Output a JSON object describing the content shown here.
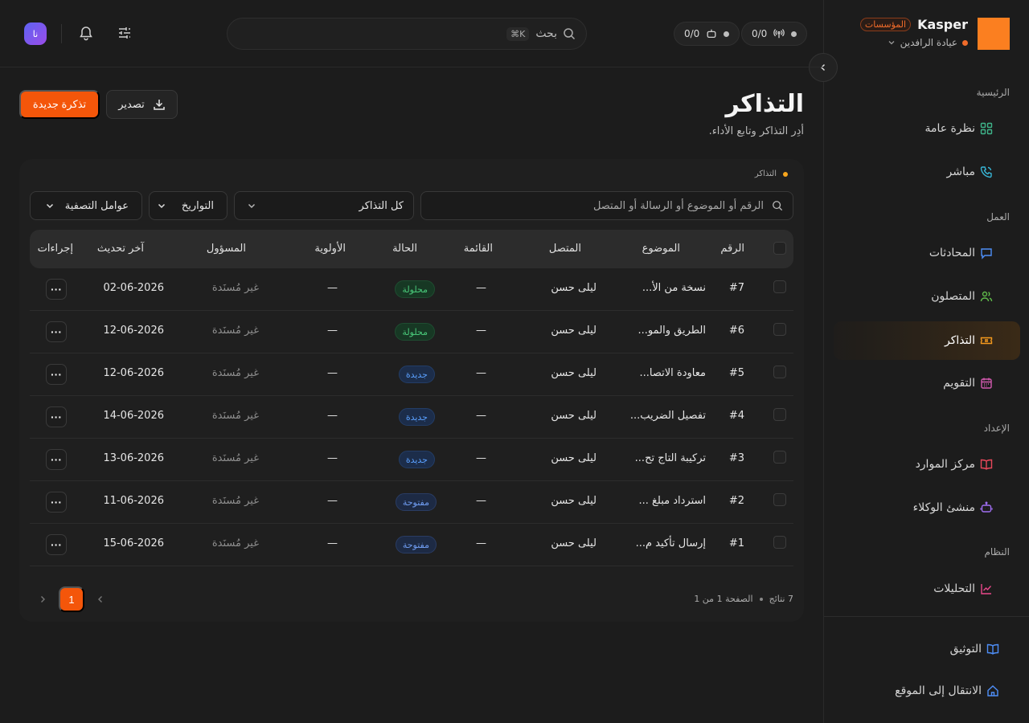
{
  "sidebar": {
    "brand": "Kasper",
    "brand_badge": "المؤسسات",
    "org": "عيادة الرافدين",
    "sections": {
      "home": "الرئيسية",
      "work": "العمل",
      "setup": "الإعداد",
      "system": "النظام"
    },
    "items": {
      "overview": "نظرة عامة",
      "live": "مباشر",
      "conversations": "المحادثات",
      "contacts": "المتصلون",
      "tickets": "التذاكر",
      "calendar": "التقويم",
      "resources": "مركز الموارد",
      "agent_builder": "منشئ الوكلاء",
      "analytics": "التحليلات",
      "docs": "التوثيق",
      "go_to_site": "الانتقال إلى الموقع"
    }
  },
  "header": {
    "counter_1": "0/0",
    "counter_2": "0/0",
    "search_label": "بحث",
    "search_shortcut": "⌘K",
    "avatar_initials": "نا"
  },
  "page": {
    "title": "التذاكر",
    "subtitle": "أدِر التذاكر وتابع الأداء.",
    "new_ticket": "تذكرة جديدة",
    "export": "تصدير",
    "breadcrumb": "التذاكر"
  },
  "filters": {
    "search_placeholder": "الرقم أو الموضوع أو الرسالة أو المتصل",
    "all_tickets": "كل التذاكر",
    "dates": "التواريخ",
    "filters": "عوامل التصفية"
  },
  "table": {
    "headers": {
      "number": "الرقم",
      "subject": "الموضوع",
      "contact": "المتصل",
      "list": "القائمة",
      "status": "الحالة",
      "priority": "الأولوية",
      "assignee": "المسؤول",
      "updated": "آخر تحديث",
      "actions": "إجراءات"
    },
    "rows": [
      {
        "number": "#7",
        "subject": "نسخة من الأ...",
        "contact": "ليلى حسن",
        "list": "—",
        "status": "محلولة",
        "status_kind": "resolved",
        "priority": "—",
        "assignee": "غير مُسنَدة",
        "updated": "02-06-2026",
        "actions": "···"
      },
      {
        "number": "#6",
        "subject": "الطريق والمو...",
        "contact": "ليلى حسن",
        "list": "—",
        "status": "محلولة",
        "status_kind": "resolved",
        "priority": "—",
        "assignee": "غير مُسنَدة",
        "updated": "12-06-2026",
        "actions": "···"
      },
      {
        "number": "#5",
        "subject": "معاودة الاتصا...",
        "contact": "ليلى حسن",
        "list": "—",
        "status": "جديدة",
        "status_kind": "new",
        "priority": "—",
        "assignee": "غير مُسنَدة",
        "updated": "12-06-2026",
        "actions": "···"
      },
      {
        "number": "#4",
        "subject": "تفصيل الضريب...",
        "contact": "ليلى حسن",
        "list": "—",
        "status": "جديدة",
        "status_kind": "new",
        "priority": "—",
        "assignee": "غير مُسنَدة",
        "updated": "14-06-2026",
        "actions": "···"
      },
      {
        "number": "#3",
        "subject": "تركيبة التاج تح...",
        "contact": "ليلى حسن",
        "list": "—",
        "status": "جديدة",
        "status_kind": "new",
        "priority": "—",
        "assignee": "غير مُسنَدة",
        "updated": "13-06-2026",
        "actions": "···"
      },
      {
        "number": "#2",
        "subject": "استرداد مبلغ ...",
        "contact": "ليلى حسن",
        "list": "—",
        "status": "مفتوحة",
        "status_kind": "open",
        "priority": "—",
        "assignee": "غير مُسنَدة",
        "updated": "11-06-2026",
        "actions": "···"
      },
      {
        "number": "#1",
        "subject": "إرسال تأكيد م...",
        "contact": "ليلى حسن",
        "list": "—",
        "status": "مفتوحة",
        "status_kind": "open",
        "priority": "—",
        "assignee": "غير مُسنَدة",
        "updated": "15-06-2026",
        "actions": "···"
      }
    ]
  },
  "pagination": {
    "results": "7 نتائج",
    "page_info": "الصفحة 1 من 1",
    "current": "1"
  }
}
